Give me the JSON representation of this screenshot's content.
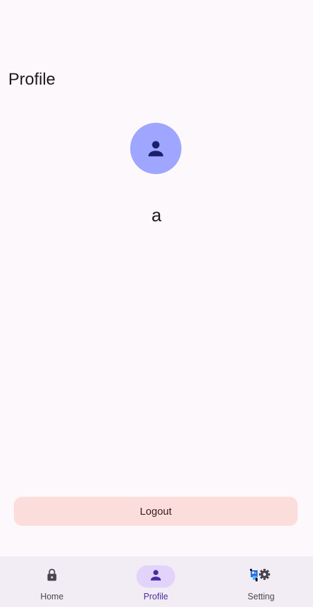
{
  "header": {
    "title": "Profile"
  },
  "profile": {
    "avatar_icon": "person-icon",
    "username": "a"
  },
  "actions": {
    "logout_label": "Logout"
  },
  "bottom_nav": {
    "items": [
      {
        "label": "Home",
        "icon": "lock-icon",
        "active": false
      },
      {
        "label": "Profile",
        "icon": "person-icon",
        "active": true
      },
      {
        "label": "Setting",
        "icon": "gear-icon",
        "active": false
      }
    ]
  },
  "colors": {
    "background": "#fdf8fc",
    "avatar_bg": "#9ea6ff",
    "avatar_icon": "#1a1f6b",
    "logout_bg": "#fbdedc",
    "nav_bg": "#f2ecf4",
    "nav_active_pill": "#e2d3fb",
    "nav_active_text": "#4a2ba0"
  }
}
